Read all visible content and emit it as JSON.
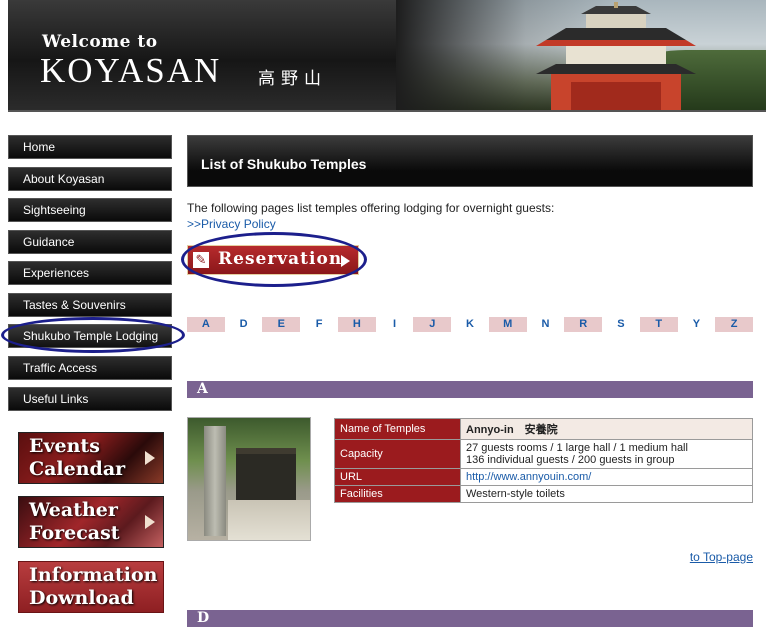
{
  "header": {
    "welcome": "Welcome to",
    "site_name": "KOYASAN",
    "site_kanji": "高野山"
  },
  "sidebar": {
    "items": [
      {
        "label": "Home"
      },
      {
        "label": "About Koyasan"
      },
      {
        "label": "Sightseeing"
      },
      {
        "label": "Guidance"
      },
      {
        "label": "Experiences"
      },
      {
        "label": "Tastes & Souvenirs"
      },
      {
        "label": "Shukubo Temple Lodging"
      },
      {
        "label": "Traffic Access"
      },
      {
        "label": "Useful Links"
      }
    ],
    "active_index": 6
  },
  "banners": {
    "events": {
      "line1": "Events",
      "line2": "Calendar"
    },
    "weather": {
      "line1": "Weather",
      "line2": "Forecast"
    },
    "info": {
      "line1": "Information",
      "line2": "Download"
    }
  },
  "main": {
    "title": "List of Shukubo Temples",
    "intro": "The following pages list temples offering lodging for overnight guests:",
    "privacy_link": ">>Privacy Policy",
    "reservation_label": "Reservation",
    "alphabet": [
      "A",
      "D",
      "E",
      "F",
      "H",
      "I",
      "J",
      "K",
      "M",
      "N",
      "R",
      "S",
      "T",
      "Y",
      "Z"
    ],
    "sections": [
      {
        "letter": "A"
      },
      {
        "letter": "D"
      }
    ],
    "temple": {
      "rows": [
        {
          "key": "Name of Temples",
          "value": "Annyo-in　安養院"
        },
        {
          "key": "Capacity",
          "value": "27 guests rooms / 1 large hall / 1 medium hall",
          "value2": "136 individual guests / 200 guests in group"
        },
        {
          "key": "URL",
          "value": "http://www.annyouin.com/"
        },
        {
          "key": "Facilities",
          "value": "Western-style toilets"
        }
      ]
    },
    "to_top": "to Top-page"
  },
  "colors": {
    "nav_bg": "#0a0a0a",
    "accent_red": "#9b1b1e",
    "section_purple": "#7a6391",
    "alpha_pink": "#e8c9cb",
    "link_blue": "#1a5ba8",
    "highlight_ring": "#1c1f8c"
  }
}
